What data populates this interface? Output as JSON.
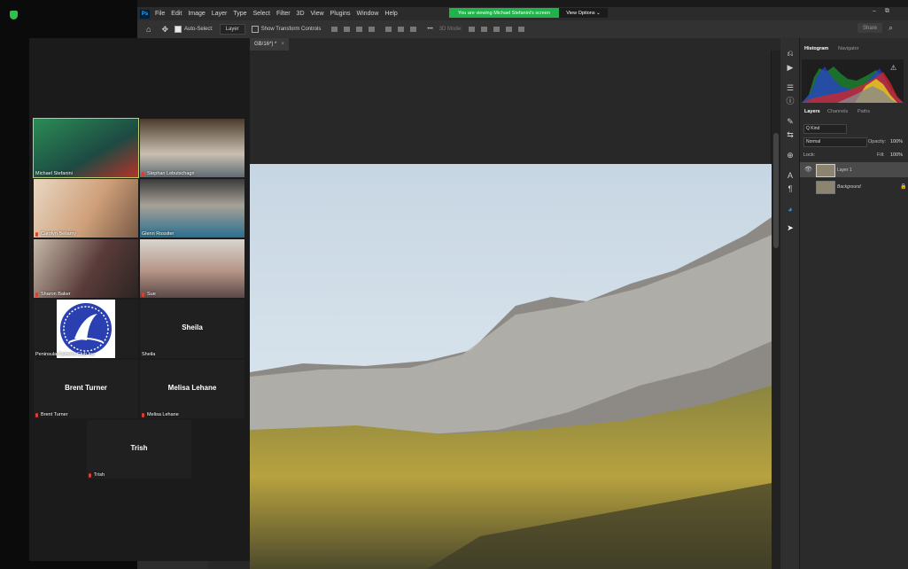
{
  "share": {
    "banner": "You are viewing Michael Stefanini's screen",
    "view_options": "View Options ⌄"
  },
  "menu": [
    "File",
    "Edit",
    "Image",
    "Layer",
    "Type",
    "Select",
    "Filter",
    "3D",
    "View",
    "Plugins",
    "Window",
    "Help"
  ],
  "ps_logo": "Ps",
  "options_bar": {
    "auto_select": "Auto-Select:",
    "auto_select_target": "Layer",
    "transform": "Show Transform Controls",
    "mode_3d": "3D Mode:",
    "share": "Share"
  },
  "document": {
    "tab_label": "GB/16*) *",
    "close": "×"
  },
  "panels": {
    "tabs_top": [
      "Histogram",
      "Navigator"
    ],
    "tabs_layers": [
      "Layers",
      "Channels",
      "Paths"
    ],
    "kind": "Q Kind",
    "blend_mode": "Normal",
    "opacity_label": "Opacity:",
    "opacity_value": "100%",
    "lock_label": "Lock:",
    "fill_label": "Fill:",
    "fill_value": "100%",
    "layers": [
      {
        "name": "Layer 1"
      },
      {
        "name": "Background"
      }
    ]
  },
  "participants": [
    {
      "name": "Michael Stefanini",
      "muted": false,
      "active": true
    },
    {
      "name": "Stephan Lebutschagri",
      "muted": true
    },
    {
      "name": "Carolyn Bellamy",
      "muted": true
    },
    {
      "name": "Glenn Rossiter",
      "muted": false
    },
    {
      "name": "Sharon Baker",
      "muted": true
    },
    {
      "name": "Sue",
      "muted": true
    },
    {
      "name": "Peninsula Camera Club Inc",
      "muted": false
    },
    {
      "name": "Sheila",
      "display": "Sheila",
      "muted": false
    },
    {
      "name": "Brent Turner",
      "display": "Brent Turner",
      "muted": true
    },
    {
      "name": "Melisa Lehane",
      "display": "Melisa Lehane",
      "muted": true
    },
    {
      "name": "Trish",
      "display": "Trish",
      "muted": true
    }
  ],
  "colors": {
    "share_green": "#21b24b",
    "zoom_bg": "#0b0b0b",
    "ps_panel": "#2b2b2b",
    "mic_red": "#e23a2e"
  }
}
